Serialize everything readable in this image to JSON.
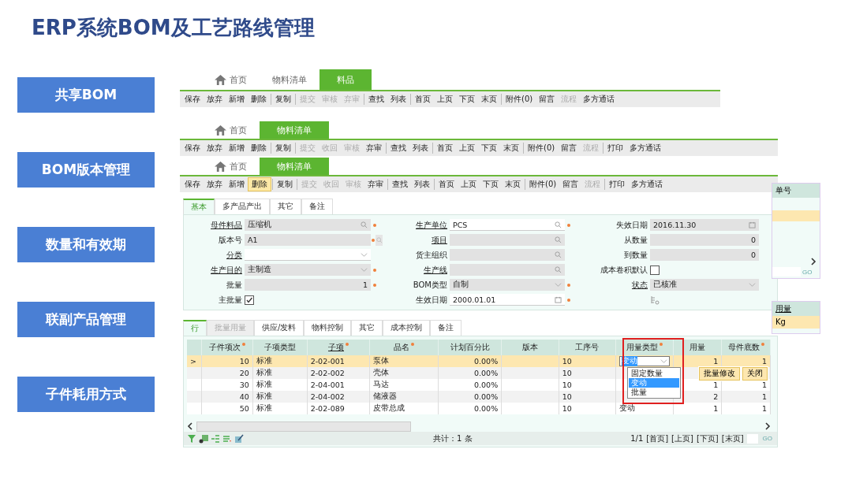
{
  "title": "ERP系统BOM及工艺路线管理",
  "side_labels": [
    "共享BOM",
    "BOM版本管理",
    "数量和有效期",
    "联副产品管理",
    "子件耗用方式"
  ],
  "windows": [
    {
      "tabs": [
        {
          "label": "首页",
          "kind": "home",
          "selected": false
        },
        {
          "label": "物料清单",
          "kind": "page",
          "selected": false
        },
        {
          "label": "料品",
          "kind": "page",
          "selected": true
        }
      ],
      "toolbar": [
        [
          {
            "label": "保存",
            "disabled": false,
            "highlighted": false
          },
          {
            "label": "放弃",
            "disabled": false,
            "highlighted": false
          },
          {
            "label": "新增",
            "disabled": false,
            "highlighted": false
          },
          {
            "label": "删除",
            "disabled": false,
            "highlighted": false
          }
        ],
        [
          {
            "label": "复制",
            "disabled": false,
            "highlighted": false
          }
        ],
        [
          {
            "label": "提交",
            "disabled": true,
            "highlighted": false
          },
          {
            "label": "审核",
            "disabled": true,
            "highlighted": false
          },
          {
            "label": "弃审",
            "disabled": true,
            "highlighted": false
          }
        ],
        [
          {
            "label": "查找",
            "disabled": false,
            "highlighted": false
          },
          {
            "label": "列表",
            "disabled": false,
            "highlighted": false
          }
        ],
        [
          {
            "label": "首页",
            "disabled": false,
            "highlighted": false
          },
          {
            "label": "上页",
            "disabled": false,
            "highlighted": false
          },
          {
            "label": "下页",
            "disabled": false,
            "highlighted": false
          },
          {
            "label": "末页",
            "disabled": false,
            "highlighted": false
          }
        ],
        [
          {
            "label": "附件(0)",
            "disabled": false,
            "highlighted": false
          },
          {
            "label": "留言",
            "disabled": false,
            "highlighted": false
          },
          {
            "label": "流程",
            "disabled": true,
            "highlighted": false
          },
          {
            "label": "多方通话",
            "disabled": false,
            "highlighted": false
          }
        ]
      ]
    },
    {
      "tabs": [
        {
          "label": "首页",
          "kind": "home",
          "selected": false
        },
        {
          "label": "物料清单",
          "kind": "page",
          "selected": true
        }
      ],
      "toolbar": [
        [
          {
            "label": "保存",
            "disabled": false,
            "highlighted": false
          },
          {
            "label": "放弃",
            "disabled": false,
            "highlighted": false
          },
          {
            "label": "新增",
            "disabled": false,
            "highlighted": false
          },
          {
            "label": "删除",
            "disabled": false,
            "highlighted": false
          }
        ],
        [
          {
            "label": "复制",
            "disabled": false,
            "highlighted": false
          }
        ],
        [
          {
            "label": "提交",
            "disabled": true,
            "highlighted": false
          },
          {
            "label": "收回",
            "disabled": true,
            "highlighted": false
          },
          {
            "label": "审核",
            "disabled": true,
            "highlighted": false
          },
          {
            "label": "弃审",
            "disabled": false,
            "highlighted": false
          }
        ],
        [
          {
            "label": "查找",
            "disabled": false,
            "highlighted": false
          },
          {
            "label": "列表",
            "disabled": false,
            "highlighted": false
          }
        ],
        [
          {
            "label": "首页",
            "disabled": false,
            "highlighted": false
          },
          {
            "label": "上页",
            "disabled": false,
            "highlighted": false
          },
          {
            "label": "下页",
            "disabled": false,
            "highlighted": false
          },
          {
            "label": "末页",
            "disabled": false,
            "highlighted": false
          }
        ],
        [
          {
            "label": "附件(0)",
            "disabled": false,
            "highlighted": false
          },
          {
            "label": "留言",
            "disabled": false,
            "highlighted": false
          },
          {
            "label": "流程",
            "disabled": true,
            "highlighted": false
          }
        ],
        [
          {
            "label": "打印",
            "disabled": false,
            "highlighted": false
          },
          {
            "label": "多方通话",
            "disabled": false,
            "highlighted": false
          }
        ]
      ]
    },
    {
      "tabs": [
        {
          "label": "首页",
          "kind": "home",
          "selected": false
        },
        {
          "label": "物料清单",
          "kind": "page",
          "selected": true
        }
      ],
      "toolbar": [
        [
          {
            "label": "保存",
            "disabled": false,
            "highlighted": false
          },
          {
            "label": "放弃",
            "disabled": false,
            "highlighted": false
          },
          {
            "label": "新增",
            "disabled": false,
            "highlighted": false
          },
          {
            "label": "删除",
            "disabled": false,
            "highlighted": true
          }
        ],
        [
          {
            "label": "复制",
            "disabled": false,
            "highlighted": false
          }
        ],
        [
          {
            "label": "提交",
            "disabled": true,
            "highlighted": false
          },
          {
            "label": "收回",
            "disabled": true,
            "highlighted": false
          },
          {
            "label": "审核",
            "disabled": true,
            "highlighted": false
          },
          {
            "label": "弃审",
            "disabled": false,
            "highlighted": false
          }
        ],
        [
          {
            "label": "查找",
            "disabled": false,
            "highlighted": false
          },
          {
            "label": "列表",
            "disabled": false,
            "highlighted": false
          }
        ],
        [
          {
            "label": "首页",
            "disabled": false,
            "highlighted": false
          },
          {
            "label": "上页",
            "disabled": false,
            "highlighted": false
          },
          {
            "label": "下页",
            "disabled": false,
            "highlighted": false
          },
          {
            "label": "末页",
            "disabled": false,
            "highlighted": false
          }
        ],
        [
          {
            "label": "附件(0)",
            "disabled": false,
            "highlighted": false
          },
          {
            "label": "留言",
            "disabled": false,
            "highlighted": false
          },
          {
            "label": "流程",
            "disabled": true,
            "highlighted": false
          }
        ],
        [
          {
            "label": "打印",
            "disabled": false,
            "highlighted": false
          },
          {
            "label": "多方通话",
            "disabled": false,
            "highlighted": false
          }
        ]
      ]
    }
  ],
  "form_tabs": [
    {
      "label": "基本",
      "selected": true
    },
    {
      "label": "多产品产出",
      "selected": false
    },
    {
      "label": "其它",
      "selected": false
    },
    {
      "label": "备注",
      "selected": false
    }
  ],
  "form_columns": [
    [
      {
        "label": "母件料品",
        "value": "压缩机",
        "kind": "lookup",
        "required": true,
        "link": true,
        "editable": false
      },
      {
        "label": "版本号",
        "value": "A1",
        "kind": "text-search",
        "required": true,
        "link": false,
        "editable": false
      },
      {
        "label": "分类",
        "kind": "select",
        "required": false,
        "link": true,
        "editable": true
      },
      {
        "label": "生产目的",
        "value": "主制造",
        "kind": "select",
        "required": true,
        "link": true,
        "editable": false
      },
      {
        "label": "批量",
        "value": "1",
        "kind": "number",
        "required": true,
        "link": false,
        "editable": false
      },
      {
        "label": "主批量",
        "kind": "checkbox",
        "checked": true,
        "link": false
      }
    ],
    [
      {
        "label": "生产单位",
        "value": "PCS",
        "kind": "lookup",
        "required": true,
        "link": true,
        "editable": true
      },
      {
        "label": "项目",
        "kind": "lookup",
        "required": false,
        "link": true,
        "editable": false
      },
      {
        "label": "货主组织",
        "kind": "lookup",
        "required": false,
        "link": false,
        "editable": false
      },
      {
        "label": "生产线",
        "kind": "lookup",
        "required": false,
        "link": true,
        "editable": false
      },
      {
        "label": "BOM类型",
        "value": "自制",
        "kind": "select",
        "required": true,
        "link": false,
        "editable": false
      },
      {
        "label": "生效日期",
        "value": "2000.01.01",
        "kind": "date",
        "required": true,
        "link": false,
        "editable": true
      }
    ],
    [
      {
        "label": "失效日期",
        "value": "2016.11.30",
        "kind": "date",
        "required": false,
        "link": false,
        "editable": false
      },
      {
        "label": "从数量",
        "value": "0",
        "kind": "number",
        "required": false,
        "link": false,
        "editable": false
      },
      {
        "label": "到数量",
        "value": "0",
        "kind": "number",
        "required": false,
        "link": false,
        "editable": false
      },
      {
        "label": "成本卷积默认",
        "kind": "checkbox",
        "checked": false,
        "link": false
      },
      {
        "label": "状态",
        "value": "已核准",
        "kind": "select",
        "required": false,
        "link": true,
        "editable": false
      },
      {
        "kind": "tool"
      }
    ]
  ],
  "grid_tabs": [
    {
      "label": "行",
      "selected": true,
      "disabled": false
    },
    {
      "label": "批量用量",
      "selected": false,
      "disabled": true
    },
    {
      "label": "供应/发料",
      "selected": false,
      "disabled": false
    },
    {
      "label": "物料控制",
      "selected": false,
      "disabled": false
    },
    {
      "label": "其它",
      "selected": false,
      "disabled": false
    },
    {
      "label": "成本控制",
      "selected": false,
      "disabled": false
    },
    {
      "label": "备注",
      "selected": false,
      "disabled": false
    }
  ],
  "grid": {
    "columns": [
      {
        "label": "子件项次",
        "required": true,
        "link": false,
        "editing": false
      },
      {
        "label": "子项类型",
        "required": false,
        "link": false,
        "editing": false
      },
      {
        "label": "子项",
        "required": true,
        "link": true,
        "editing": false
      },
      {
        "label": "品名",
        "required": true,
        "link": false,
        "editing": false
      },
      {
        "label": "计划百分比",
        "required": false,
        "link": false,
        "editing": false
      },
      {
        "label": "版本",
        "required": false,
        "link": false,
        "editing": false
      },
      {
        "label": "工序号",
        "required": false,
        "link": false,
        "editing": false
      },
      {
        "label": "用量类型",
        "required": true,
        "link": false,
        "editing": true
      },
      {
        "label": "用量",
        "required": false,
        "link": false,
        "editing": false
      },
      {
        "label": "母件底数",
        "required": true,
        "link": false,
        "editing": false
      }
    ],
    "rows": [
      {
        "selected": true,
        "marker": ">",
        "cells": [
          "10",
          "标准",
          "2-02-001",
          "泵体",
          "0.00%",
          null,
          "10",
          "变动",
          "1",
          "1"
        ]
      },
      {
        "selected": false,
        "cells": [
          "20",
          "标准",
          "2-02-002",
          "壳体",
          "0.00%",
          null,
          "10",
          null,
          null,
          null
        ]
      },
      {
        "selected": false,
        "cells": [
          "30",
          "标准",
          "2-04-001",
          "马达",
          "0.00%",
          null,
          "10",
          null,
          "1",
          "1"
        ]
      },
      {
        "selected": false,
        "cells": [
          "40",
          "标准",
          "2-04-002",
          "储液器",
          "0.00%",
          null,
          "10",
          null,
          "2",
          "1"
        ]
      },
      {
        "selected": false,
        "cells": [
          "50",
          "标准",
          "2-02-089",
          "皮带总成",
          "0.00%",
          null,
          "10",
          "变动",
          "1",
          "1"
        ]
      }
    ],
    "dropdown_options": [
      {
        "label": "固定数量",
        "selected": false
      },
      {
        "label": "变动",
        "selected": true
      },
      {
        "label": "批量",
        "selected": false
      }
    ],
    "popup_buttons": [
      "批量修改",
      "关闭"
    ],
    "total": "共计：1 条",
    "page_info": "1/1",
    "pager_links": [
      "[首页]",
      "[上页]",
      "[下页]",
      "[末页]"
    ],
    "go": "GO"
  },
  "back_window": {
    "header": "单号",
    "go": "GO",
    "header2": "用量",
    "unit": "Kg"
  }
}
